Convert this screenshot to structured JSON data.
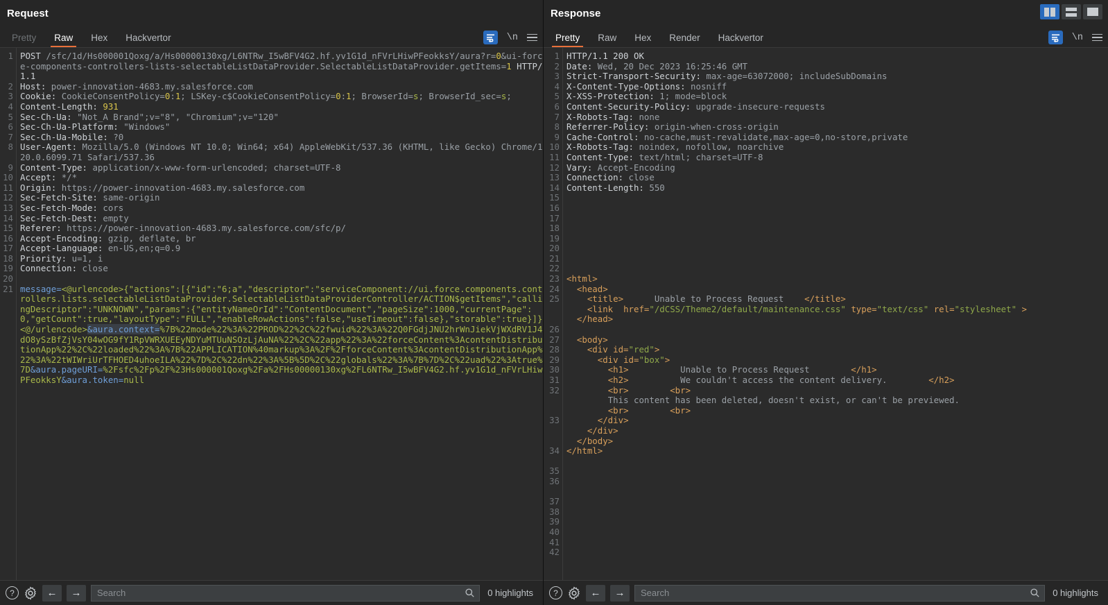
{
  "request": {
    "title": "Request",
    "tabs": [
      {
        "label": "Pretty",
        "state": "dim"
      },
      {
        "label": "Raw",
        "state": "active"
      },
      {
        "label": "Hex",
        "state": "normal"
      },
      {
        "label": "Hackvertor",
        "state": "normal"
      }
    ],
    "tools": {
      "wrap_icon": "word-wrap-icon",
      "newline_label": "\\n",
      "menu_icon": "hamburger-menu-icon"
    },
    "lines": [
      {
        "n": "1",
        "segs": [
          {
            "t": "POST ",
            "c": "k"
          },
          {
            "t": "/sfc/1d/Hs000001Qoxg/a/Hs00000130xg/L6NTRw_I5wBFV4G2.hf.yv1G1d_nFVrLHiwPFeokksY/aura?r=",
            "c": "v"
          },
          {
            "t": "0",
            "c": "y"
          },
          {
            "t": "&ui-force-components-controllers-lists-selectableListDataProvider.SelectableListDataProvider.getItems=",
            "c": "v"
          },
          {
            "t": "1",
            "c": "y"
          },
          {
            "t": " HTTP/1.1",
            "c": "k"
          }
        ]
      },
      {
        "n": "2",
        "segs": [
          {
            "t": "Host: ",
            "c": "k"
          },
          {
            "t": "power-innovation-4683.my.salesforce.com",
            "c": "v"
          }
        ]
      },
      {
        "n": "3",
        "segs": [
          {
            "t": "Cookie: ",
            "c": "k"
          },
          {
            "t": "CookieConsentPolicy=",
            "c": "v"
          },
          {
            "t": "0",
            "c": "y"
          },
          {
            "t": ":",
            "c": "v"
          },
          {
            "t": "1",
            "c": "y"
          },
          {
            "t": "; LSKey-c$CookieConsentPolicy=",
            "c": "v"
          },
          {
            "t": "0",
            "c": "y"
          },
          {
            "t": ":",
            "c": "v"
          },
          {
            "t": "1",
            "c": "y"
          },
          {
            "t": "; BrowserId=",
            "c": "v"
          },
          {
            "t": "s",
            "c": "g"
          },
          {
            "t": "; BrowserId_sec=",
            "c": "v"
          },
          {
            "t": "s",
            "c": "g"
          },
          {
            "t": ";",
            "c": "v"
          }
        ]
      },
      {
        "n": "4",
        "segs": [
          {
            "t": "Content-Length: ",
            "c": "k"
          },
          {
            "t": "931",
            "c": "y"
          }
        ]
      },
      {
        "n": "5",
        "segs": [
          {
            "t": "Sec-Ch-Ua: ",
            "c": "k"
          },
          {
            "t": "\"Not_A Brand\";v=\"8\", \"Chromium\";v=\"120\"",
            "c": "v"
          }
        ]
      },
      {
        "n": "6",
        "segs": [
          {
            "t": "Sec-Ch-Ua-Platform: ",
            "c": "k"
          },
          {
            "t": "\"Windows\"",
            "c": "v"
          }
        ]
      },
      {
        "n": "7",
        "segs": [
          {
            "t": "Sec-Ch-Ua-Mobile: ",
            "c": "k"
          },
          {
            "t": "?0",
            "c": "v"
          }
        ]
      },
      {
        "n": "8",
        "segs": [
          {
            "t": "User-Agent: ",
            "c": "k"
          },
          {
            "t": "Mozilla/5.0 (Windows NT 10.0; Win64; x64) AppleWebKit/537.36 (KHTML, like Gecko) Chrome/120.0.6099.71 Safari/537.36",
            "c": "v"
          }
        ]
      },
      {
        "n": "9",
        "segs": [
          {
            "t": "Content-Type: ",
            "c": "k"
          },
          {
            "t": "application/x-www-form-urlencoded; charset=UTF-8",
            "c": "v"
          }
        ]
      },
      {
        "n": "10",
        "segs": [
          {
            "t": "Accept: ",
            "c": "k"
          },
          {
            "t": "*/*",
            "c": "v"
          }
        ]
      },
      {
        "n": "11",
        "segs": [
          {
            "t": "Origin: ",
            "c": "k"
          },
          {
            "t": "https://power-innovation-4683.my.salesforce.com",
            "c": "v"
          }
        ]
      },
      {
        "n": "12",
        "segs": [
          {
            "t": "Sec-Fetch-Site: ",
            "c": "k"
          },
          {
            "t": "same-origin",
            "c": "v"
          }
        ]
      },
      {
        "n": "13",
        "segs": [
          {
            "t": "Sec-Fetch-Mode: ",
            "c": "k"
          },
          {
            "t": "cors",
            "c": "v"
          }
        ]
      },
      {
        "n": "14",
        "segs": [
          {
            "t": "Sec-Fetch-Dest: ",
            "c": "k"
          },
          {
            "t": "empty",
            "c": "v"
          }
        ]
      },
      {
        "n": "15",
        "segs": [
          {
            "t": "Referer: ",
            "c": "k"
          },
          {
            "t": "https://power-innovation-4683.my.salesforce.com/sfc/p/",
            "c": "v"
          }
        ]
      },
      {
        "n": "16",
        "segs": [
          {
            "t": "Accept-Encoding: ",
            "c": "k"
          },
          {
            "t": "gzip, deflate, br",
            "c": "v"
          }
        ]
      },
      {
        "n": "17",
        "segs": [
          {
            "t": "Accept-Language: ",
            "c": "k"
          },
          {
            "t": "en-US,en;q=0.9",
            "c": "v"
          }
        ]
      },
      {
        "n": "18",
        "segs": [
          {
            "t": "Priority: ",
            "c": "k"
          },
          {
            "t": "u=1, i",
            "c": "v"
          }
        ]
      },
      {
        "n": "19",
        "segs": [
          {
            "t": "Connection: ",
            "c": "k"
          },
          {
            "t": "close",
            "c": "v"
          }
        ]
      },
      {
        "n": "20",
        "segs": []
      },
      {
        "n": "21",
        "segs": [
          {
            "t": "message=",
            "c": "b"
          },
          {
            "t": "\n",
            "c": "k"
          },
          {
            "t": "<@urlencode>{\"actions\":[{\"id\":\"6;a\",\"descriptor\":\"serviceComponent://ui.force.components.controllers.lists.selectableListDataProvider.SelectableListDataProviderController/ACTION$getItems\",\"callingDescriptor\":\"UNKNOWN\",\"params\":{\"entityNameOrId\":\"ContentDocument\",\"pageSize\":1000,\"currentPage\":0,\"getCount\":true,\"layoutType\":\"FULL\",\"enableRowActions\":false,\"useTimeout\":false},\"storable\":true}]}<@/urlencode>",
            "c": "g"
          },
          {
            "t": "&aura.context=",
            "c": "b"
          },
          {
            "t": "\n",
            "c": "k"
          },
          {
            "t": "%7B%22mode%22%3A%22PROD%22%2C%22fwuid%22%3A%22Q0FGdjJNU2hrWnJiekVjWXdRV1J4dO8ySzBfZjVsY04wOG9fY1RpVWRXUEEyNDYuMTUuNSOzLjAuNA%22%2C%22app%22%3A%22forceContent%3AcontentDistributionApp%22%2C%22loaded%22%3A%7B%22APPLICATION%40markup%3A%2F%2FforceContent%3AcontentDistributionApp%22%3A%22tWIWriUrTFHOED4uhoeILA%22%7D%2C%22dn%22%3A%5B%5D%2C%22globals%22%3A%7B%7D%2C%22uad%22%3Atrue%7D",
            "c": "g"
          },
          {
            "t": "&aura.pageURI=",
            "c": "b"
          },
          {
            "t": "\n",
            "c": "k"
          },
          {
            "t": "%2Fsfc%2Fp%2F%23Hs000001Qoxg%2Fa%2FHs00000130xg%2FL6NTRw_I5wBFV4G2.hf.yv1G1d_nFVrLHiwPFeokksY",
            "c": "g"
          },
          {
            "t": "&aura.token=",
            "c": "b"
          },
          {
            "t": "null",
            "c": "g"
          }
        ]
      }
    ],
    "status": {
      "help_icon": "help-icon",
      "settings_icon": "gear-icon",
      "back_icon": "back-arrow-icon",
      "forward_icon": "forward-arrow-icon",
      "search_placeholder": "Search",
      "search_value": "",
      "search_icon": "magnifier-icon",
      "highlights": "0 highlights"
    }
  },
  "response": {
    "title": "Response",
    "tabs": [
      {
        "label": "Pretty",
        "state": "active"
      },
      {
        "label": "Raw",
        "state": "normal"
      },
      {
        "label": "Hex",
        "state": "normal"
      },
      {
        "label": "Render",
        "state": "normal"
      },
      {
        "label": "Hackvertor",
        "state": "normal"
      }
    ],
    "tools": {
      "wrap_icon": "word-wrap-icon",
      "newline_label": "\\n",
      "menu_icon": "hamburger-menu-icon"
    },
    "layout_buttons": [
      {
        "name": "side-by-side-layout",
        "state": "active"
      },
      {
        "name": "stacked-layout",
        "state": "normal"
      },
      {
        "name": "single-pane-layout",
        "state": "normal"
      }
    ],
    "lines": [
      {
        "n": "1",
        "segs": [
          {
            "t": "HTTP/1.1 ",
            "c": "k"
          },
          {
            "t": "200",
            "c": "k"
          },
          {
            "t": " OK",
            "c": "k"
          }
        ]
      },
      {
        "n": "2",
        "segs": [
          {
            "t": "Date: ",
            "c": "k"
          },
          {
            "t": "Wed, 20 Dec 2023 16:25:46 GMT",
            "c": "v"
          }
        ]
      },
      {
        "n": "3",
        "segs": [
          {
            "t": "Strict-Transport-Security: ",
            "c": "k"
          },
          {
            "t": "max-age=63072000; includeSubDomains",
            "c": "v"
          }
        ]
      },
      {
        "n": "4",
        "segs": [
          {
            "t": "X-Content-Type-Options: ",
            "c": "k"
          },
          {
            "t": "nosniff",
            "c": "v"
          }
        ]
      },
      {
        "n": "5",
        "segs": [
          {
            "t": "X-XSS-Protection: ",
            "c": "k"
          },
          {
            "t": "1; mode=block",
            "c": "v"
          }
        ]
      },
      {
        "n": "6",
        "segs": [
          {
            "t": "Content-Security-Policy: ",
            "c": "k"
          },
          {
            "t": "upgrade-insecure-requests",
            "c": "v"
          }
        ]
      },
      {
        "n": "7",
        "segs": [
          {
            "t": "X-Robots-Tag: ",
            "c": "k"
          },
          {
            "t": "none",
            "c": "v"
          }
        ]
      },
      {
        "n": "8",
        "segs": [
          {
            "t": "Referrer-Policy: ",
            "c": "k"
          },
          {
            "t": "origin-when-cross-origin",
            "c": "v"
          }
        ]
      },
      {
        "n": "9",
        "segs": [
          {
            "t": "Cache-Control: ",
            "c": "k"
          },
          {
            "t": "no-cache,must-revalidate,max-age=0,no-store,private",
            "c": "v"
          }
        ]
      },
      {
        "n": "10",
        "segs": [
          {
            "t": "X-Robots-Tag: ",
            "c": "k"
          },
          {
            "t": "noindex, nofollow, noarchive",
            "c": "v"
          }
        ]
      },
      {
        "n": "11",
        "segs": [
          {
            "t": "Content-Type: ",
            "c": "k"
          },
          {
            "t": "text/html; charset=UTF-8",
            "c": "v"
          }
        ]
      },
      {
        "n": "12",
        "segs": [
          {
            "t": "Vary: ",
            "c": "k"
          },
          {
            "t": "Accept-Encoding",
            "c": "v"
          }
        ]
      },
      {
        "n": "13",
        "segs": [
          {
            "t": "Connection: ",
            "c": "k"
          },
          {
            "t": "close",
            "c": "v"
          }
        ]
      },
      {
        "n": "14",
        "segs": [
          {
            "t": "Content-Length: ",
            "c": "k"
          },
          {
            "t": "550",
            "c": "v"
          }
        ]
      },
      {
        "n": "15",
        "segs": []
      },
      {
        "n": "16",
        "segs": []
      },
      {
        "n": "17",
        "segs": []
      },
      {
        "n": "18",
        "segs": []
      },
      {
        "n": "19",
        "segs": []
      },
      {
        "n": "20",
        "segs": []
      },
      {
        "n": "21",
        "segs": []
      },
      {
        "n": "22",
        "segs": []
      },
      {
        "n": "23",
        "segs": [
          {
            "t": "<html>",
            "c": "o"
          }
        ]
      },
      {
        "n": "24",
        "segs": [
          {
            "t": "  <head>",
            "c": "o"
          }
        ]
      },
      {
        "n": "25",
        "segs": [
          {
            "t": "    <title>",
            "c": "o"
          },
          {
            "t": "\n",
            "c": "k"
          },
          {
            "t": "      Unable to Process Request",
            "c": "v"
          },
          {
            "t": "\n",
            "c": "k"
          },
          {
            "t": "    </title>",
            "c": "o"
          }
        ]
      },
      {
        "n": "26",
        "segs": [
          {
            "t": "    <link ",
            "c": "o"
          },
          {
            "t": " href=",
            "c": "o"
          },
          {
            "t": "\"/dCSS/Theme2/default/maintenance.css\"",
            "c": "gr"
          },
          {
            "t": " type=",
            "c": "o"
          },
          {
            "t": "\"text/css\"",
            "c": "gr"
          },
          {
            "t": " rel=",
            "c": "o"
          },
          {
            "t": "\"stylesheet\"",
            "c": "gr"
          },
          {
            "t": " >",
            "c": "o"
          }
        ]
      },
      {
        "n": "27",
        "segs": [
          {
            "t": "  </head>",
            "c": "o"
          }
        ]
      },
      {
        "n": "28",
        "segs": []
      },
      {
        "n": "29",
        "segs": [
          {
            "t": "  <body>",
            "c": "o"
          }
        ]
      },
      {
        "n": "30",
        "segs": [
          {
            "t": "    <div id=",
            "c": "o"
          },
          {
            "t": "\"red\"",
            "c": "gr"
          },
          {
            "t": ">",
            "c": "o"
          }
        ]
      },
      {
        "n": "31",
        "segs": [
          {
            "t": "      <div id=",
            "c": "o"
          },
          {
            "t": "\"box\"",
            "c": "gr"
          },
          {
            "t": ">",
            "c": "o"
          }
        ]
      },
      {
        "n": "32",
        "segs": [
          {
            "t": "        <h1>",
            "c": "o"
          },
          {
            "t": "\n",
            "c": "k"
          },
          {
            "t": "          Unable to Process Request",
            "c": "v"
          },
          {
            "t": "\n",
            "c": "k"
          },
          {
            "t": "        </h1>",
            "c": "o"
          }
        ]
      },
      {
        "n": "33",
        "segs": [
          {
            "t": "        <h2>",
            "c": "o"
          },
          {
            "t": "\n",
            "c": "k"
          },
          {
            "t": "          We couldn't access the content delivery.",
            "c": "v"
          },
          {
            "t": "\n",
            "c": "k"
          },
          {
            "t": "        </h2>",
            "c": "o"
          }
        ]
      },
      {
        "n": "34",
        "segs": [
          {
            "t": "        <br>",
            "c": "o"
          },
          {
            "t": "\n",
            "c": "k"
          },
          {
            "t": "        <br>",
            "c": "o"
          }
        ]
      },
      {
        "n": "35",
        "segs": [
          {
            "t": "        This content has been deleted, doesn't exist, or can't be previewed.",
            "c": "v"
          }
        ]
      },
      {
        "n": "36",
        "segs": [
          {
            "t": "        <br>",
            "c": "o"
          },
          {
            "t": "\n",
            "c": "k"
          },
          {
            "t": "        <br>",
            "c": "o"
          }
        ]
      },
      {
        "n": "37",
        "segs": [
          {
            "t": "      </div>",
            "c": "o"
          }
        ]
      },
      {
        "n": "38",
        "segs": [
          {
            "t": "    </div>",
            "c": "o"
          }
        ]
      },
      {
        "n": "39",
        "segs": [
          {
            "t": "  </body>",
            "c": "o"
          }
        ]
      },
      {
        "n": "40",
        "segs": [
          {
            "t": "</html>",
            "c": "o"
          }
        ]
      },
      {
        "n": "41",
        "segs": []
      },
      {
        "n": "42",
        "segs": []
      }
    ],
    "status": {
      "help_icon": "help-icon",
      "settings_icon": "gear-icon",
      "back_icon": "back-arrow-icon",
      "forward_icon": "forward-arrow-icon",
      "search_placeholder": "Search",
      "search_value": "",
      "search_icon": "magnifier-icon",
      "highlights": "0 highlights"
    }
  },
  "colors": {
    "accent_orange": "#e8703a",
    "accent_blue": "#2a6bbd",
    "editor_bg": "#2b2b2b",
    "chrome_bg": "#262626"
  }
}
